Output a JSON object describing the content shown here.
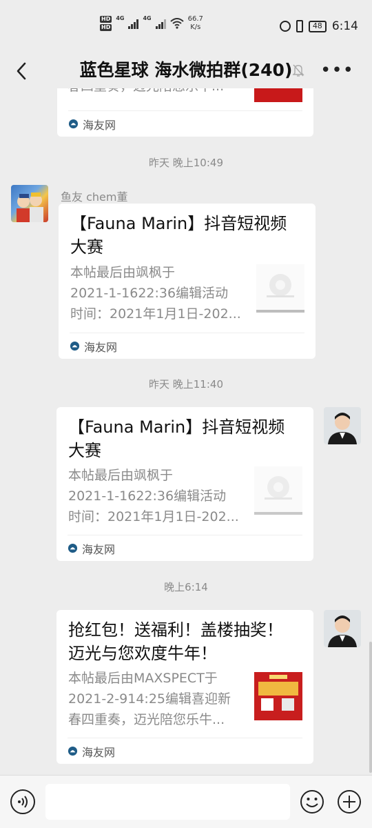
{
  "status_bar": {
    "hd1": "HD",
    "hd2": "HD",
    "net1": "4G",
    "net2": "4G",
    "speed_value": "66.7",
    "speed_unit": "K/s",
    "battery": "48",
    "time": "6:14"
  },
  "header": {
    "title": "蓝色星球 海水微拍群(240)"
  },
  "messages": [
    {
      "desc": "春四重奏，迈光陪您乐牛...",
      "source": "海友网"
    },
    {
      "timestamp": "昨天 晚上10:49",
      "sender": "鱼友 chem董",
      "title": "【Fauna Marin】抖音短视频大赛",
      "desc": "本帖最后由飒枫于\n2021-1-1622:36编辑活动\n时间：2021年1月1日-202...",
      "source": "海友网"
    },
    {
      "timestamp": "昨天 晚上11:40",
      "title": "【Fauna Marin】抖音短视频大赛",
      "desc": "本帖最后由飒枫于\n2021-1-1622:36编辑活动\n时间：2021年1月1日-202...",
      "source": "海友网"
    },
    {
      "timestamp": "晚上6:14",
      "title": "抢红包！送福利！盖楼抽奖！迈光与您欢度牛年！",
      "desc": "本帖最后由MAXSPECT于\n2021-2-914:25编辑喜迎新\n春四重奏，迈光陪您乐牛...",
      "source": "海友网"
    }
  ],
  "input": {
    "placeholder": ""
  }
}
